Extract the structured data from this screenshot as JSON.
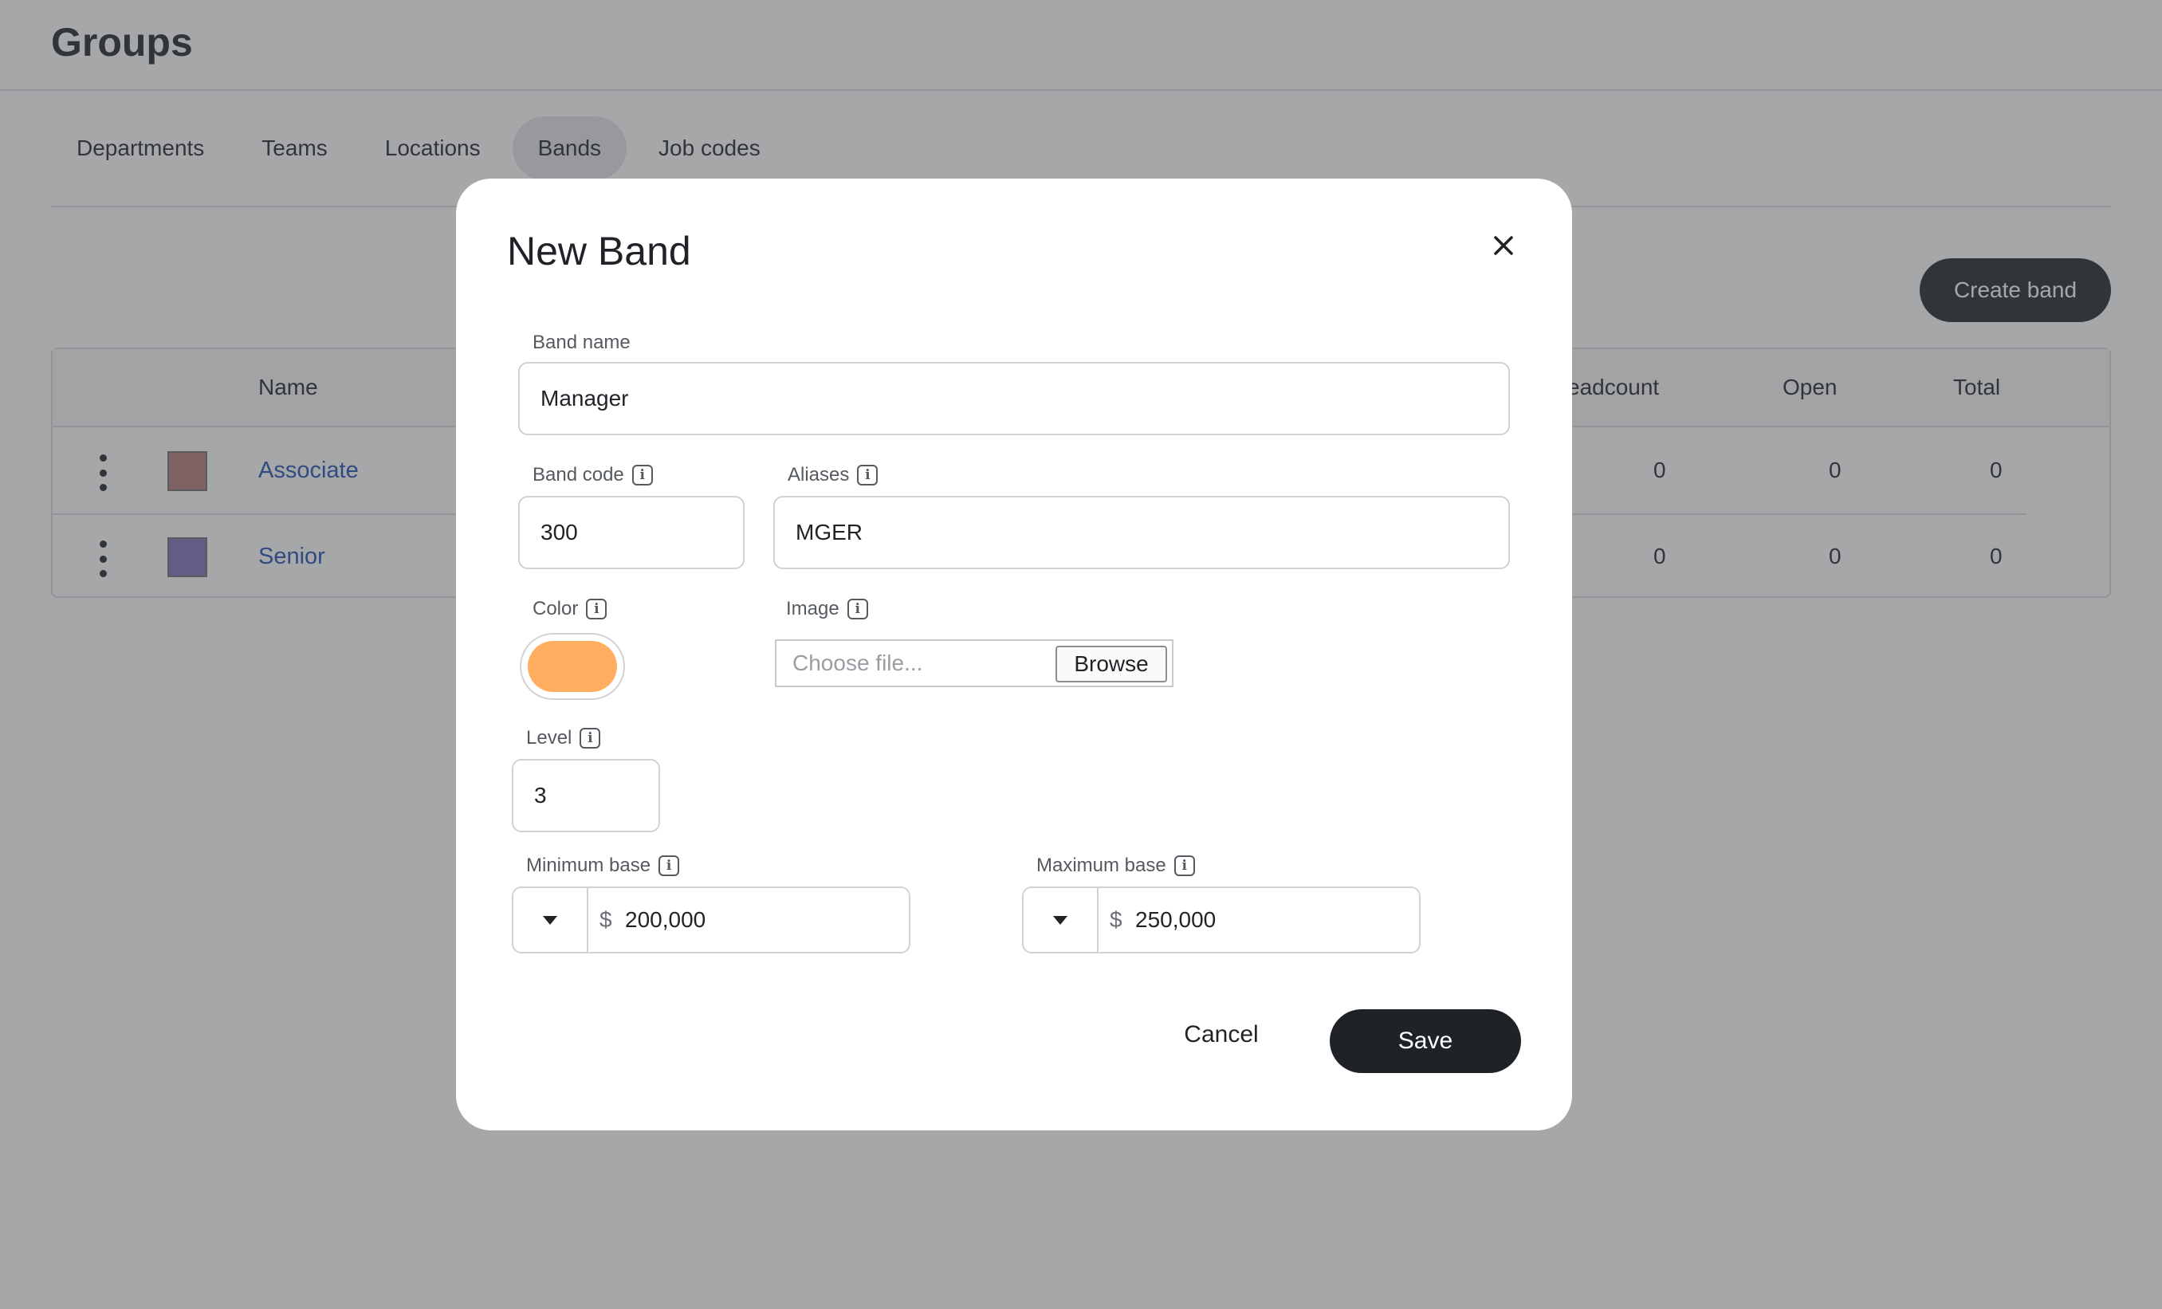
{
  "page": {
    "title": "Groups",
    "tabs": [
      {
        "label": "Departments",
        "active": false
      },
      {
        "label": "Teams",
        "active": false
      },
      {
        "label": "Locations",
        "active": false
      },
      {
        "label": "Bands",
        "active": true
      },
      {
        "label": "Job codes",
        "active": false
      }
    ],
    "create_button": "Create band",
    "table": {
      "headers": {
        "name": "Name",
        "headcount": "eadcount",
        "open": "Open",
        "total": "Total"
      },
      "rows": [
        {
          "name": "Associate",
          "color": "#b4797a",
          "headcount": "0",
          "open": "0",
          "total": "0"
        },
        {
          "name": "Senior",
          "color": "#7f6fbf",
          "headcount": "0",
          "open": "0",
          "total": "0"
        }
      ]
    }
  },
  "modal": {
    "title": "New Band",
    "close_icon": "close-icon",
    "band_name": {
      "label": "Band name",
      "value": "Manager"
    },
    "band_code": {
      "label": "Band code",
      "value": "300"
    },
    "aliases": {
      "label": "Aliases",
      "value": "MGER"
    },
    "color": {
      "label": "Color",
      "value": "#ffad5e"
    },
    "image": {
      "label": "Image",
      "placeholder": "Choose file...",
      "browse": "Browse"
    },
    "level": {
      "label": "Level",
      "value": "3"
    },
    "minimum_base": {
      "label": "Minimum base",
      "symbol": "$",
      "value": "200,000"
    },
    "maximum_base": {
      "label": "Maximum base",
      "symbol": "$",
      "value": "250,000"
    },
    "cancel": "Cancel",
    "save": "Save",
    "info_icon": "i"
  }
}
